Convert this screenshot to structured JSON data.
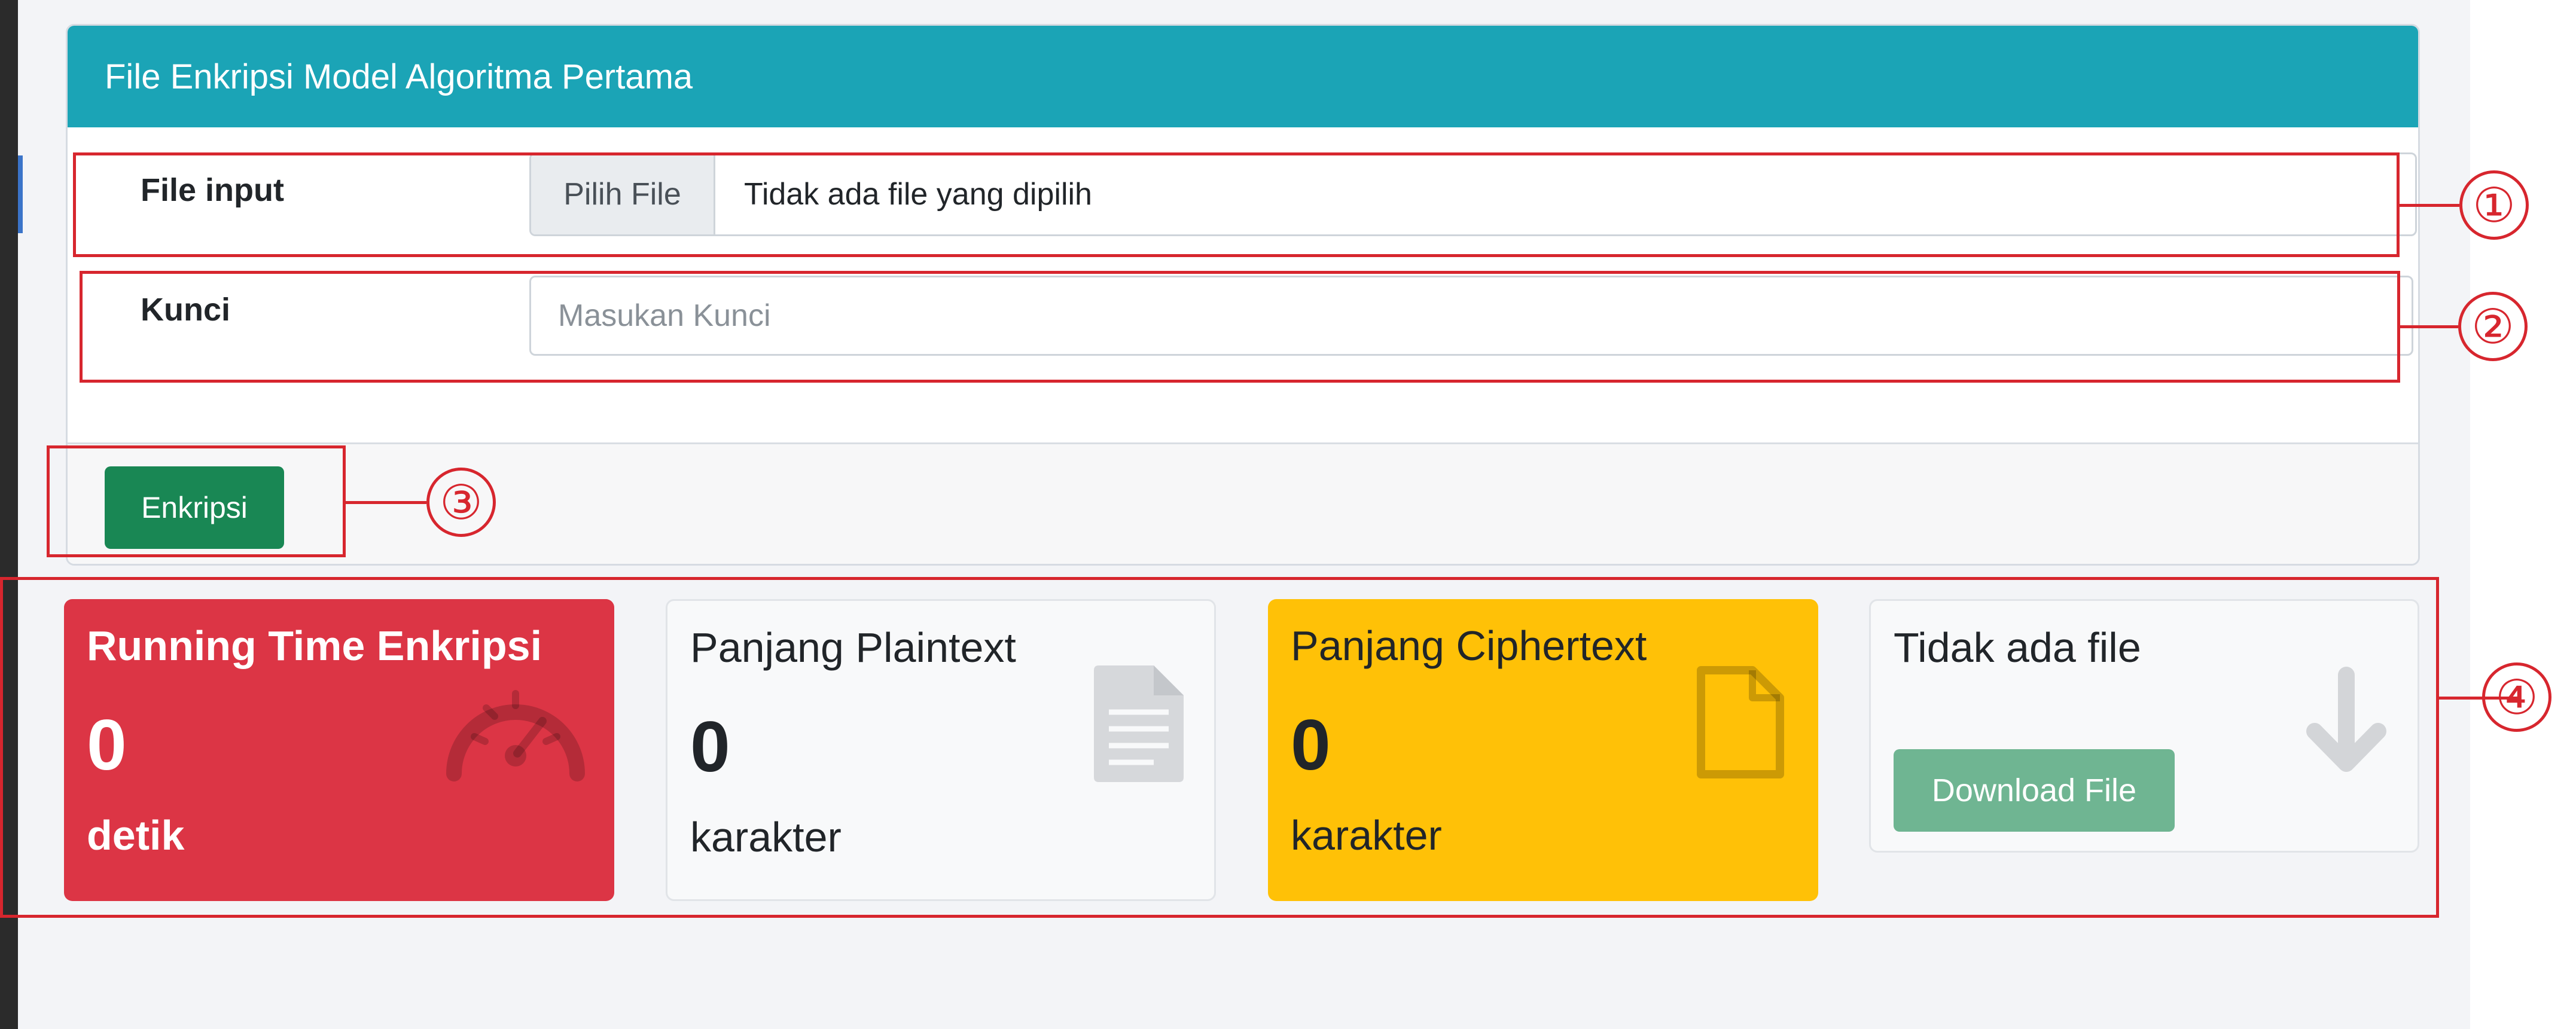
{
  "card": {
    "title": "File Enkripsi Model Algoritma Pertama",
    "file_input": {
      "label": "File input",
      "button_label": "Pilih File",
      "status": "Tidak ada file yang dipilih"
    },
    "key_input": {
      "label": "Kunci",
      "placeholder": "Masukan Kunci",
      "value": ""
    },
    "submit_label": "Enkripsi"
  },
  "stats": [
    {
      "title": "Running Time Enkripsi",
      "value": "0",
      "unit": "detik",
      "icon": "speedometer-icon",
      "color": "#dc3545"
    },
    {
      "title": "Panjang Plaintext",
      "value": "0",
      "unit": "karakter",
      "icon": "file-text-icon",
      "color": "#f8f9fa"
    },
    {
      "title": "Panjang Ciphertext",
      "value": "0",
      "unit": "karakter",
      "icon": "file-outline-icon",
      "color": "#ffc107"
    },
    {
      "title": "Tidak ada file",
      "button_label": "Download File",
      "icon": "arrow-down-icon",
      "color": "#f8f9fa"
    }
  ],
  "annotations": [
    "①",
    "②",
    "③",
    "④"
  ],
  "colors": {
    "header": "#1ba4b6",
    "success": "#198754",
    "danger": "#dc3545",
    "warning": "#ffc107",
    "annotation": "#d7262e"
  }
}
